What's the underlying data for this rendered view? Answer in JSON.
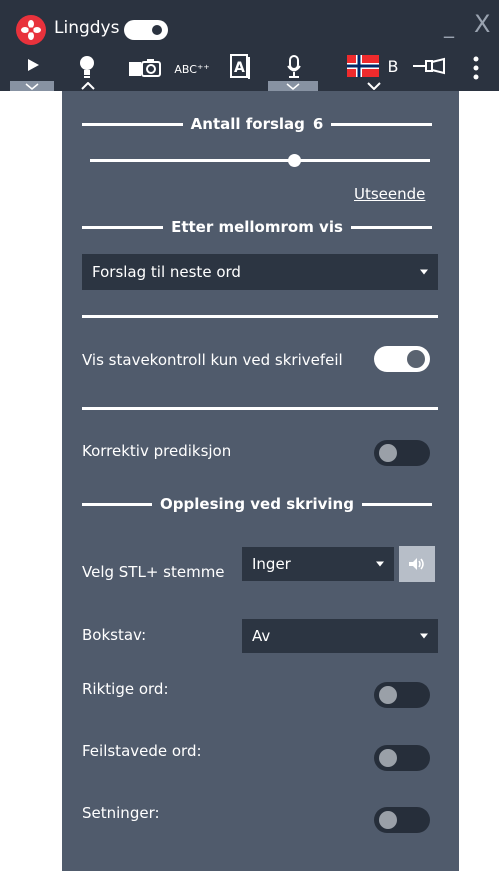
{
  "app": {
    "name": "Lingdys"
  },
  "window": {
    "minimize": "_",
    "close": "X"
  },
  "toolbar": {
    "language_letter": "B",
    "spell_label": "ABC"
  },
  "panel": {
    "suggestions": {
      "label": "Antall forslag",
      "count": "6",
      "level": 0.6,
      "appearance_link": "Utseende"
    },
    "after_space": {
      "label": "Etter mellomrom vis",
      "value": "Forslag til neste ord"
    },
    "spellcheck_only": {
      "label": "Vis stavekontroll kun ved skrivefeil",
      "on": true
    },
    "corrective_prediction": {
      "label": "Korrektiv prediksjon",
      "on": false
    },
    "reading": {
      "label": "Opplesing ved skriving",
      "voice_label": "Velg STL+ stemme",
      "voice_value": "Inger",
      "letter_label": "Bokstav:",
      "letter_value": "Av",
      "correct_words_label": "Riktige ord:",
      "misspelled_words_label": "Feilstavede ord:",
      "sentences_label": "Setninger:"
    }
  },
  "colors": {
    "panel": "#505b6c",
    "topbar": "#2b3340",
    "logo": "#e8323c",
    "active_tab": "#8792a2"
  }
}
